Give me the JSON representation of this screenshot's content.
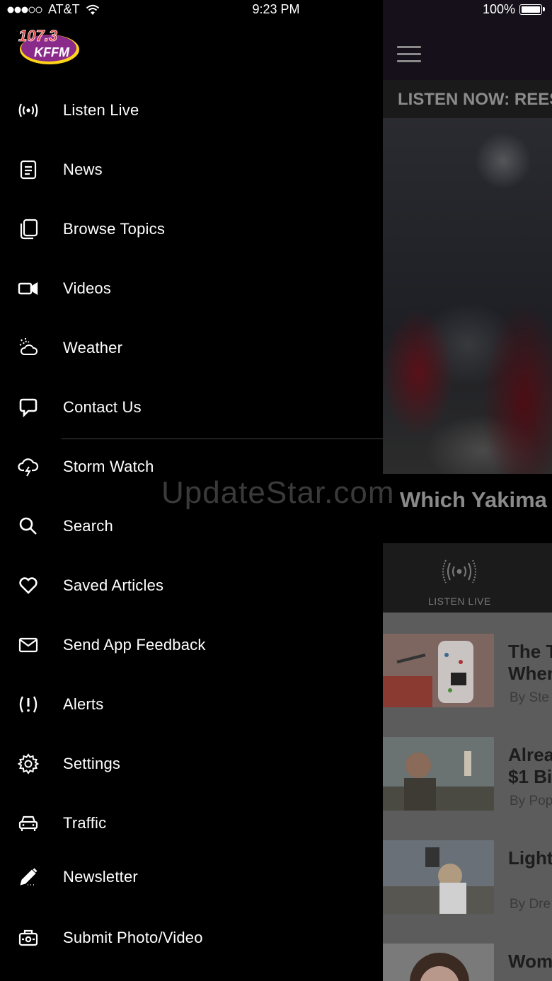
{
  "status_bar": {
    "carrier": "AT&T",
    "time": "9:23 PM",
    "battery": "100%",
    "battery_level": 1.0
  },
  "logo": {
    "top_text": "107.3",
    "bottom_text": "KFFM"
  },
  "menu": {
    "items": [
      {
        "label": "Listen Live",
        "icon": "broadcast-icon"
      },
      {
        "label": "News",
        "icon": "news-icon"
      },
      {
        "label": "Browse Topics",
        "icon": "topics-icon"
      },
      {
        "label": "Videos",
        "icon": "video-camera-icon"
      },
      {
        "label": "Weather",
        "icon": "weather-icon"
      },
      {
        "label": "Contact Us",
        "icon": "chat-bubble-icon"
      },
      {
        "label": "Storm Watch",
        "icon": "storm-icon"
      },
      {
        "label": "Search",
        "icon": "search-icon"
      },
      {
        "label": "Saved Articles",
        "icon": "heart-icon"
      },
      {
        "label": "Send App Feedback",
        "icon": "mail-icon"
      },
      {
        "label": "Alerts",
        "icon": "alert-icon"
      },
      {
        "label": "Settings",
        "icon": "gear-icon"
      },
      {
        "label": "Traffic",
        "icon": "car-icon"
      },
      {
        "label": "Newsletter",
        "icon": "pencil-icon"
      },
      {
        "label": "Submit Photo/Video",
        "icon": "camera-icon"
      }
    ]
  },
  "content": {
    "ticker": "LISTEN NOW: REES",
    "headline": "Which Yakima",
    "listen_live_label": "LISTEN LIVE",
    "articles": [
      {
        "title_line1": "The T",
        "title_line2": "When",
        "byline": "By Ste"
      },
      {
        "title_line1": "Alrea",
        "title_line2": "$1 Bi",
        "byline": "By Pop"
      },
      {
        "title_line1": "Light",
        "title_line2": "",
        "byline": "By Dre"
      },
      {
        "title_line1": "Wom",
        "title_line2": "",
        "byline": ""
      }
    ]
  },
  "watermark": "UpdateStar.com",
  "colors": {
    "drawer_bg": "#000000",
    "divider": "#444444",
    "dimmed_text": "#8a8a8a"
  }
}
